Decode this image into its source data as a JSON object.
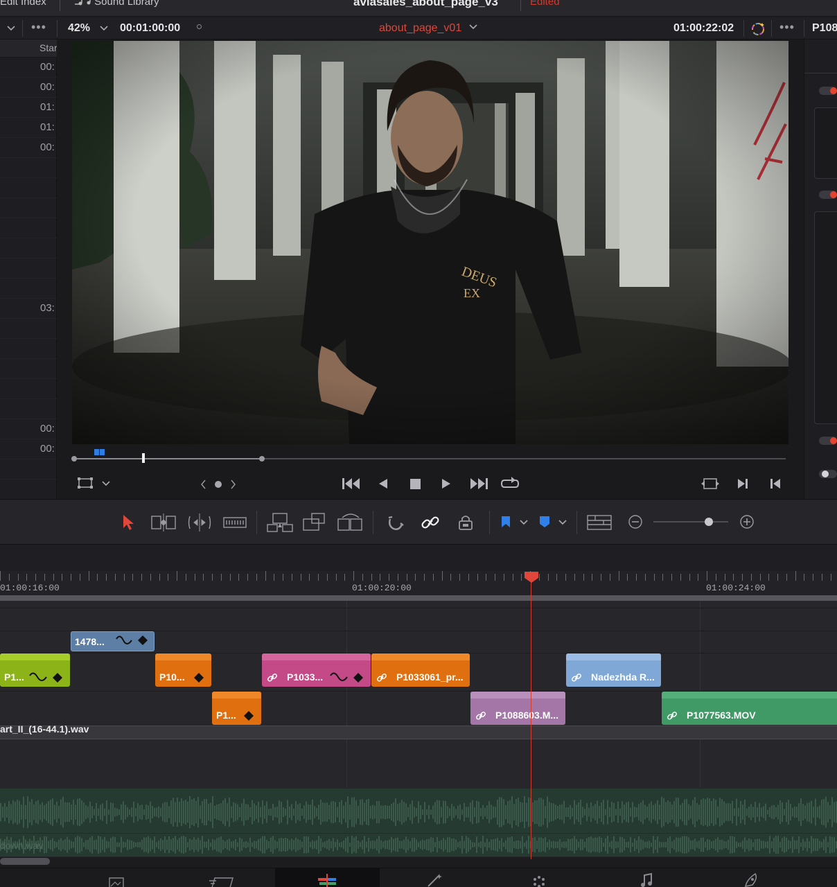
{
  "topbar": {
    "edit_index": "Edit Index",
    "sound_library": "Sound Library",
    "project_title": "aviasales_about_page_v3",
    "edited": "Edited"
  },
  "viewer_header": {
    "zoom": "42%",
    "source_timecode": "00:01:00:00",
    "timeline_name": "about_page_v01",
    "record_timecode": "01:00:22:02",
    "inspector_clip": "P108"
  },
  "media_list": {
    "column_header": "Star",
    "rows": [
      "00:",
      "00:",
      "01:",
      "01:",
      "00:",
      "03:",
      "00:",
      "00:"
    ]
  },
  "ruler": {
    "labels": [
      "01:00:16:00",
      "01:00:20:00",
      "01:00:24:00"
    ]
  },
  "clips": {
    "title_clip": "1478...",
    "green_clip": "P1...",
    "orange_a": "P10...",
    "magenta": "P1033...",
    "orange_b": "P1033061_pr...",
    "blue": "Nadezhda R...",
    "orange_c": "P1...",
    "purple": "P1088603.M...",
    "teal": "P1077563.MOV"
  },
  "audio": {
    "track1_name": "art_II_(16-44.1).wav",
    "track2_name": "down.wav"
  },
  "colors": {
    "accent_red": "#d83a2b",
    "clip_green": "#8cb318",
    "clip_orange": "#e0700f",
    "clip_magenta": "#c34a86",
    "clip_blue_title": "#5d7fa6",
    "clip_light_blue": "#7fa8d6",
    "clip_purple": "#a476a8",
    "clip_teal": "#3f9a66",
    "audio_bg": "#253a31"
  }
}
